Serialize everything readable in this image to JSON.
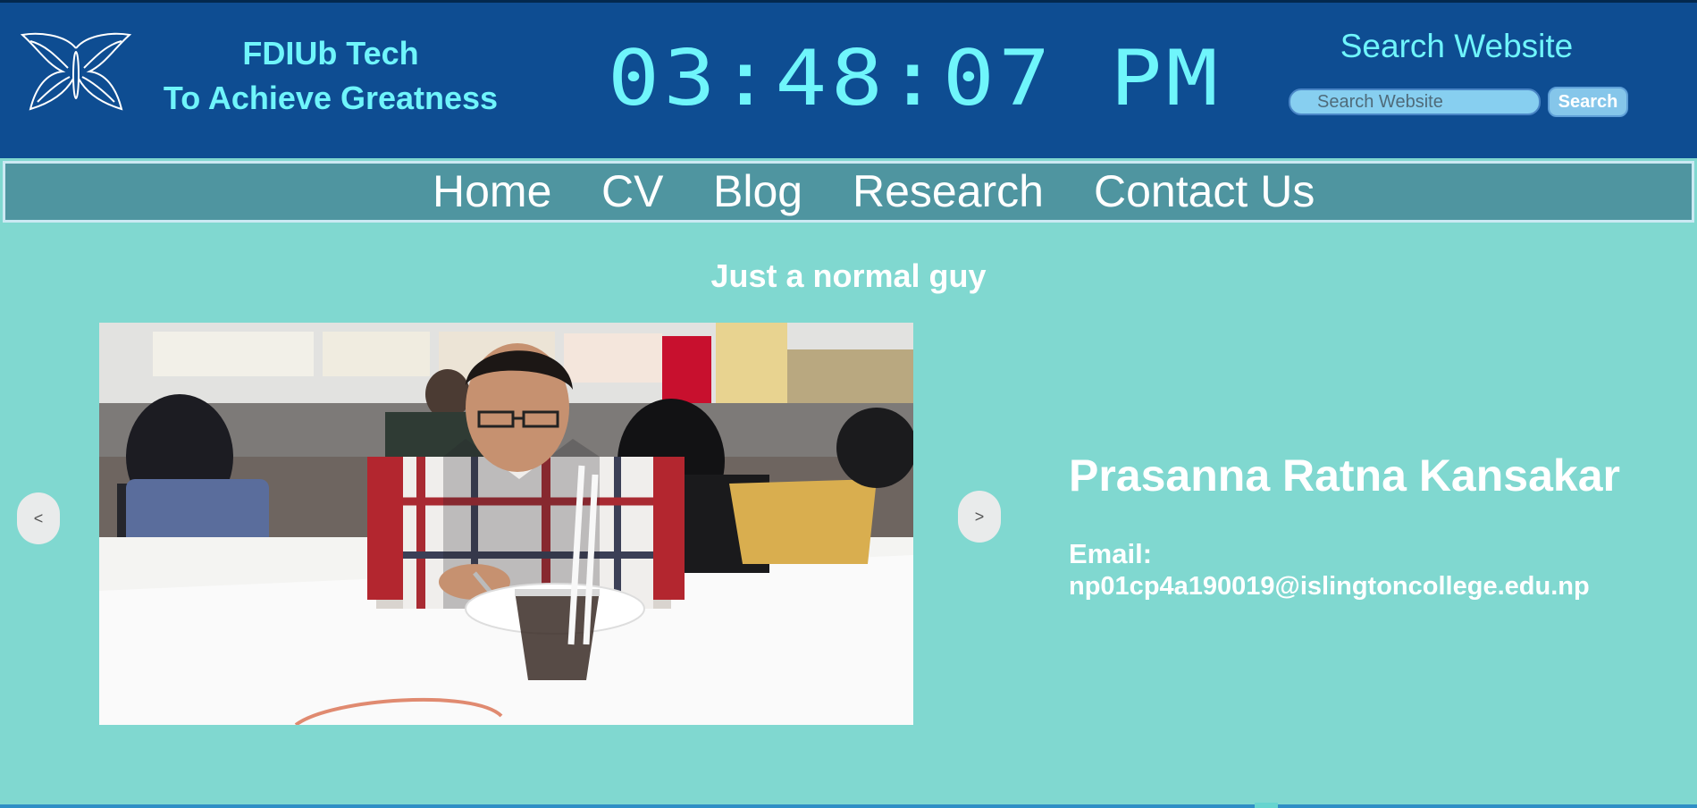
{
  "header": {
    "brand_line1": "FDIUb Tech",
    "brand_line2": "To Achieve Greatness",
    "clock": "03:48:07 PM",
    "search_title": "Search Website",
    "search_placeholder": "Search Website",
    "search_button": "Search",
    "logo_icon": "butterfly-icon"
  },
  "nav": {
    "items": [
      {
        "label": "Home"
      },
      {
        "label": "CV"
      },
      {
        "label": "Blog"
      },
      {
        "label": "Research"
      },
      {
        "label": "Contact Us"
      }
    ]
  },
  "main": {
    "tagline": "Just a normal guy",
    "prev_label": "<",
    "next_label": ">",
    "person_name": "Prasanna Ratna Kansakar",
    "email_label": "Email:",
    "email_value": "np01cp4a190019@islingtoncollege.edu.np"
  },
  "colors": {
    "header_bg": "#0e4d92",
    "accent_text": "#6ff5fb",
    "nav_bg": "#4f95a0",
    "page_bg": "#80d8d0"
  }
}
